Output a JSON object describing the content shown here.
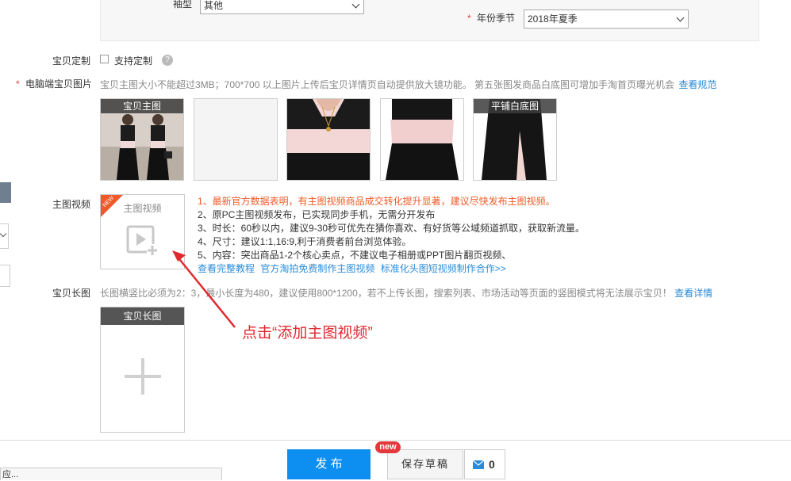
{
  "attributes": {
    "sleeve_label": "袖型",
    "sleeve_value": "其他",
    "year_season_label": "年份季节",
    "year_season_value": "2018年夏季",
    "required_mark": "*"
  },
  "custom": {
    "label": "宝贝定制",
    "checkbox_label": "支持定制",
    "help_icon": "?"
  },
  "pc_images": {
    "label": "电脑端宝贝图片",
    "hint": "宝贝主图大小不能超过3MB；700*700 以上图片上传后宝贝详情页自动提供放大镜功能。 第五张图发商品白底图可增加手淘首页曝光机会",
    "hint_link": "查看规范",
    "thumbs": [
      {
        "label": "宝贝主图",
        "kind": "two-models"
      },
      {
        "label": "",
        "kind": "empty"
      },
      {
        "label": "",
        "kind": "necklace"
      },
      {
        "label": "",
        "kind": "waist"
      },
      {
        "label": "平铺白底图",
        "kind": "skirt"
      }
    ]
  },
  "main_video": {
    "label": "主图视频",
    "badge": "NEW",
    "box_title": "主图视频",
    "icon": "video-add-icon",
    "tips": [
      "1、最新官方数据表明，有主图视频商品成交转化提升显著，建议尽快发布主图视频。",
      "2、原PC主图视频发布，已实现同步手机，无需分开发布",
      "3、时长：60秒以内，建议9-30秒可优先在猜你喜欢、有好货等公域频道抓取，获取新流量。",
      "4、尺寸：建议1:1,16:9,利于消费者前台浏览体验。",
      "5、内容：突出商品1-2个核心卖点，不建议电子相册或PPT图片翻页视频、"
    ],
    "links": [
      "查看完整教程",
      "官方淘拍免费制作主图视频",
      "标准化头图短视频制作合作>>"
    ]
  },
  "long_image": {
    "label": "宝贝长图",
    "hint": "长图横竖比必须为2：3，最小长度为480，建议使用800*1200，若不上传长图，搜索列表、市场活动等页面的竖图模式将无法展示宝贝！",
    "hint_link": "查看详情",
    "box_title": "宝贝长图",
    "icon": "plus-icon"
  },
  "annotation": {
    "text": "点击“添加主图视频”",
    "color": "#e0292f"
  },
  "footer": {
    "publish": "发 布",
    "save_draft": "保存草稿",
    "new_badge": "new",
    "message_count": "0",
    "left_text": "应..."
  },
  "colors": {
    "accent": "#0d8ff2",
    "red": "#e4393c",
    "link": "#2a8bd8",
    "tip_highlight": "#f05a28"
  }
}
